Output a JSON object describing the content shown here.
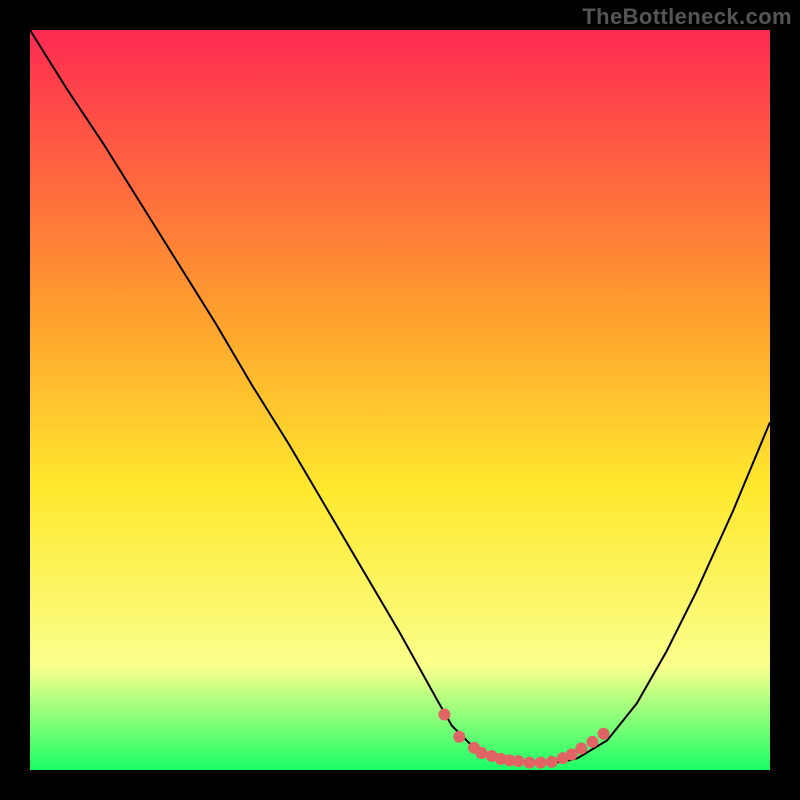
{
  "branding": {
    "watermark": "TheBottleneck.com"
  },
  "chart_data": {
    "type": "line",
    "title": "",
    "xlabel": "",
    "ylabel": "",
    "xlim": [
      0,
      100
    ],
    "ylim": [
      0,
      100
    ],
    "grid": false,
    "background_gradient": {
      "top": "#ff2a52",
      "mid_upper": "#ff9e2e",
      "mid": "#ffe92e",
      "mid_lower": "#faff8c",
      "bottom": "#1aff66"
    },
    "series": [
      {
        "name": "bottleneck-curve",
        "color": "#000000",
        "x": [
          0,
          5,
          10,
          15,
          20,
          25,
          30,
          35,
          40,
          45,
          50,
          55,
          57,
          60,
          63,
          65,
          68,
          70,
          72,
          74,
          78,
          82,
          86,
          90,
          95,
          100
        ],
        "y": [
          100,
          92,
          84.5,
          76.5,
          68.5,
          60.5,
          52,
          44,
          35.5,
          27,
          18.5,
          9.5,
          6,
          3,
          1.6,
          1.2,
          1,
          1,
          1.1,
          1.6,
          4,
          9,
          16,
          24,
          35,
          47
        ]
      },
      {
        "name": "optimal-range-markers",
        "color": "#e06464",
        "style": "points",
        "x": [
          56,
          58,
          60,
          61,
          62.4,
          63.6,
          64.8,
          66,
          67.5,
          69,
          70.5,
          72,
          73.2,
          74.5,
          76,
          77.5
        ],
        "y": [
          7.5,
          4.5,
          3,
          2.3,
          1.9,
          1.5,
          1.3,
          1.2,
          1,
          1,
          1.1,
          1.6,
          2.1,
          2.9,
          3.8,
          4.9
        ]
      }
    ]
  }
}
